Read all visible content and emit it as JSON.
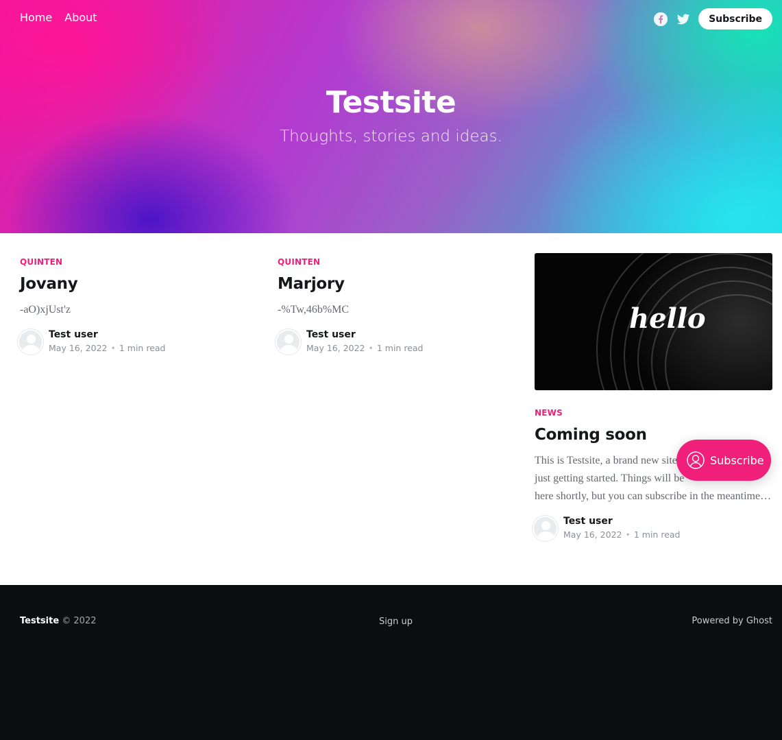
{
  "nav": {
    "items": [
      {
        "label": "Home"
      },
      {
        "label": "About"
      }
    ],
    "social": [
      "facebook-icon",
      "twitter-icon"
    ],
    "subscribe_label": "Subscribe"
  },
  "hero": {
    "title": "Testsite",
    "description": "Thoughts, stories and ideas."
  },
  "posts": [
    {
      "tag": "Quinten",
      "title": "Jovany",
      "excerpt": "-aO)xjUst'z",
      "author": "Test user",
      "date": "May 16, 2022",
      "reading_time": "1 min read"
    },
    {
      "tag": "Quinten",
      "title": "Marjory",
      "excerpt": "-%Tw,46b%MC",
      "author": "Test user",
      "date": "May 16, 2022",
      "reading_time": "1 min read"
    },
    {
      "tag": "News",
      "title": "Coming soon",
      "image_text": "hello",
      "excerpt_lines": [
        "This is Testsite, a brand new site",
        "just getting started. Things will be",
        "here shortly, but you can subscribe in the meantime…"
      ],
      "author": "Test user",
      "date": "May 16, 2022",
      "reading_time": "1 min read"
    }
  ],
  "portal": {
    "label": "Subscribe"
  },
  "footer": {
    "site": "Testsite",
    "copyright": "© 2022",
    "signup": "Sign up",
    "powered": "Powered by Ghost"
  },
  "colors": {
    "accent": "#f01f7a",
    "footer_bg": "#0c0d10"
  }
}
